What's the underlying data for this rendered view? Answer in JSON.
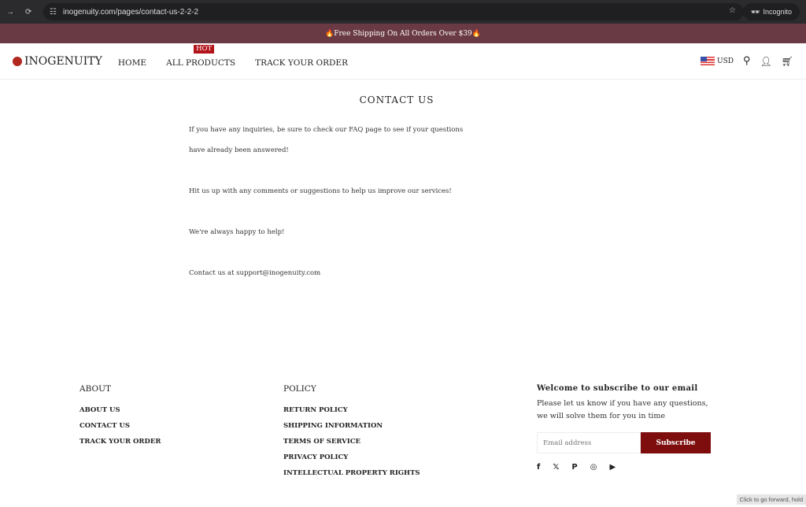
{
  "browser": {
    "url": "inogenuity.com/pages/contact-us-2-2-2",
    "profile": "Incognito",
    "tooltip": "Click to go forward, hold"
  },
  "banner": {
    "text": "🔥Free Shipping On All Orders Over $39🔥"
  },
  "header": {
    "logo": "INOGENUITY",
    "nav": [
      {
        "label": "HOME"
      },
      {
        "label": "ALL PRODUCTS",
        "badge": "HOT"
      },
      {
        "label": "TRACK YOUR ORDER"
      }
    ],
    "currency": "USD"
  },
  "main": {
    "title": "CONTACT US",
    "paragraphs": [
      "If you have any inquiries, be sure to check our FAQ page to see if your questions",
      "have already been answered!",
      "Hit us up with any comments or suggestions to help us improve our services!",
      "We're always happy to help!",
      "Contact us at support@inogenuity.com"
    ]
  },
  "footer": {
    "about": {
      "title": "ABOUT",
      "links": [
        "ABOUT US",
        "CONTACT US",
        "TRACK YOUR ORDER"
      ]
    },
    "policy": {
      "title": "POLICY",
      "links": [
        "RETURN POLICY",
        "SHIPPING INFORMATION",
        "TERMS OF SERVICE",
        "PRIVACY POLICY",
        "INTELLECTUAL PROPERTY RIGHTS"
      ]
    },
    "subscribe": {
      "title": "Welcome to subscribe to our email",
      "text1": "Please let us know if you have any questions,",
      "text2": "we will solve them for you in time",
      "placeholder": "Email address",
      "button": "Subscribe"
    },
    "social": [
      "facebook-icon",
      "x-icon",
      "pinterest-icon",
      "instagram-icon",
      "youtube-icon"
    ]
  },
  "colors": {
    "banner": "#6a3a44",
    "accent": "#7e0e0e",
    "hot": "#b3141a"
  }
}
